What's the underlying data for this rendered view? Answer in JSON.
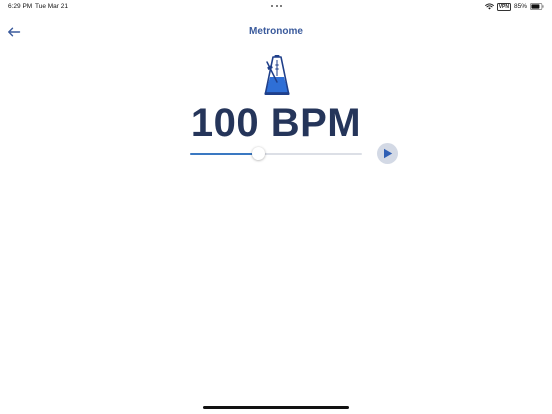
{
  "status_bar": {
    "time": "6:29 PM",
    "date": "Tue Mar 21",
    "vpn_label": "VPN",
    "battery_percent": "85%",
    "battery_level": 0.85
  },
  "nav": {
    "title": "Metronome",
    "back_icon": "arrow-left-icon"
  },
  "metronome": {
    "icon": "metronome-icon",
    "bpm_text": "100 BPM",
    "slider_fraction": 0.4,
    "play_icon": "play-icon"
  },
  "colors": {
    "accent": "#3a5a9c",
    "bpm_text": "#25355a",
    "slider_fill": "#3a78c2",
    "play_button_bg": "#d3d9e5",
    "metronome_blue": "#2f6fd6"
  }
}
